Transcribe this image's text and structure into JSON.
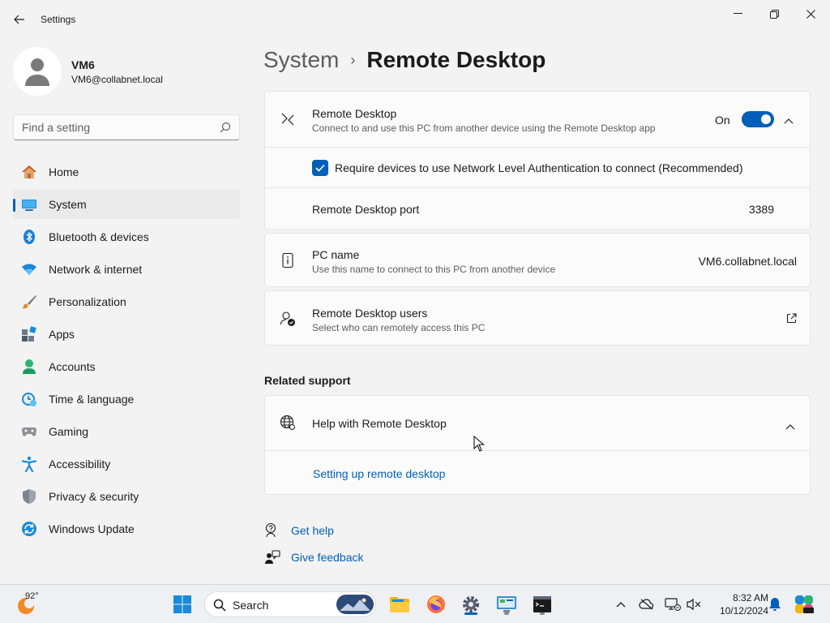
{
  "window": {
    "title": "Settings",
    "minimize_glyph": "—",
    "maximize_glyph": "❐",
    "close_glyph": "✕"
  },
  "profile": {
    "name": "VM6",
    "email": "VM6@collabnet.local"
  },
  "search": {
    "placeholder": "Find a setting"
  },
  "sidebar": {
    "items": [
      {
        "label": "Home",
        "icon": "home-icon"
      },
      {
        "label": "System",
        "icon": "system-icon",
        "active": true
      },
      {
        "label": "Bluetooth & devices",
        "icon": "bluetooth-icon"
      },
      {
        "label": "Network & internet",
        "icon": "network-icon"
      },
      {
        "label": "Personalization",
        "icon": "brush-icon"
      },
      {
        "label": "Apps",
        "icon": "apps-icon"
      },
      {
        "label": "Accounts",
        "icon": "accounts-icon"
      },
      {
        "label": "Time & language",
        "icon": "clock-icon"
      },
      {
        "label": "Gaming",
        "icon": "gamepad-icon"
      },
      {
        "label": "Accessibility",
        "icon": "accessibility-icon"
      },
      {
        "label": "Privacy & security",
        "icon": "shield-icon"
      },
      {
        "label": "Windows Update",
        "icon": "update-icon"
      }
    ]
  },
  "breadcrumb": {
    "parent": "System",
    "separator": "›",
    "current": "Remote Desktop"
  },
  "remote_desktop": {
    "title": "Remote Desktop",
    "subtitle": "Connect to and use this PC from another device using the Remote Desktop app",
    "toggle_state": "On",
    "nla_label": "Require devices to use Network Level Authentication to connect (Recommended)",
    "port_label": "Remote Desktop port",
    "port_value": "3389"
  },
  "pc_name": {
    "title": "PC name",
    "subtitle": "Use this name to connect to this PC from another device",
    "value": "VM6.collabnet.local"
  },
  "rd_users": {
    "title": "Remote Desktop users",
    "subtitle": "Select who can remotely access this PC"
  },
  "related_support": {
    "heading": "Related support",
    "help_title": "Help with Remote Desktop",
    "help_link": "Setting up remote desktop"
  },
  "footer_links": {
    "get_help": "Get help",
    "give_feedback": "Give feedback"
  },
  "taskbar": {
    "weather_temp": "92°",
    "search_label": "Search",
    "time": "8:32 AM",
    "date": "10/12/2024"
  },
  "colors": {
    "accent": "#005fb8",
    "background": "#f3f3f3",
    "card": "#fbfbfb"
  }
}
